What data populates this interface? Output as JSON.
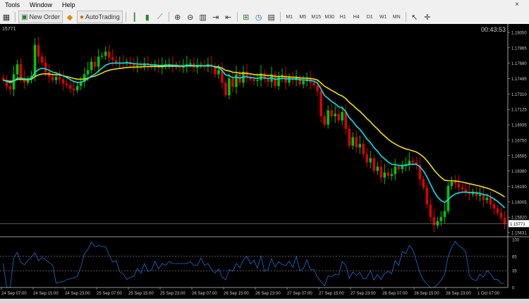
{
  "menu": {
    "items": [
      "Tools",
      "Window",
      "Help"
    ]
  },
  "toolbar": {
    "new_order_label": "New Order",
    "autotrading_label": "AutoTrading",
    "timeframes": [
      "M1",
      "M5",
      "M15",
      "M30",
      "H1",
      "H4",
      "D1",
      "W1",
      "MN"
    ],
    "icons": [
      "auto-scroll-icon",
      "chart-shift-icon",
      "bar-chart-icon",
      "zoom-in-icon",
      "zoom-out-icon",
      "tile-windows-icon",
      "indicators-icon",
      "periods-icon",
      "templates-icon",
      "cursor-icon",
      "crosshair-icon"
    ]
  },
  "chart": {
    "symbol_label": "15771",
    "countdown": "00:43:53",
    "current_price": "1.15771",
    "price_ticks": [
      "1.18050",
      "1.17865",
      "1.17680",
      "1.17495",
      "1.17310",
      "1.17125",
      "1.16935",
      "1.16750",
      "1.16565",
      "1.16380",
      "1.16190",
      "1.16005",
      "1.15820",
      "1.15631"
    ],
    "osc_ticks": [
      "100",
      "65",
      "35",
      "0"
    ],
    "time_ticks": [
      "24 Sep 07:00",
      "24 Sep 15:00",
      "24 Sep 23:00",
      "25 Sep 07:00",
      "25 Sep 15:00",
      "25 Sep 23:00",
      "26 Sep 07:00",
      "26 Sep 15:00",
      "26 Sep 23:00",
      "27 Sep 07:00",
      "27 Sep 15:00",
      "27 Sep 23:00",
      "28 Sep 07:00",
      "28 Sep 15:00",
      "28 Sep 23:00",
      "1 Oct 07:00"
    ],
    "colors": {
      "bull": "#00c800",
      "bear": "#e00000",
      "ma_fast": "#00e5ee",
      "ma_slow": "#f0e000",
      "osc": "#1e6ed8",
      "axis": "#c8c8c8"
    }
  },
  "chart_data": {
    "type": "candlestick",
    "ylim": [
      1.15631,
      1.1815
    ],
    "close": [
      1.1748,
      1.1741,
      1.1737,
      1.1755,
      1.1767,
      1.1751,
      1.1745,
      1.1749,
      1.1753,
      1.179,
      1.1776,
      1.1769,
      1.1758,
      1.1752,
      1.1748,
      1.1752,
      1.1749,
      1.1744,
      1.1742,
      1.1738,
      1.1736,
      1.1741,
      1.1746,
      1.1755,
      1.176,
      1.177,
      1.1764,
      1.1776,
      1.1777,
      1.1782,
      1.1775,
      1.1772,
      1.1768,
      1.1769,
      1.1768,
      1.177,
      1.1767,
      1.1765,
      1.1766,
      1.1765,
      1.1768,
      1.1766,
      1.1764,
      1.1766,
      1.1763,
      1.1765,
      1.1767,
      1.1767,
      1.1764,
      1.1766,
      1.1763,
      1.1765,
      1.1767,
      1.1768,
      1.1763,
      1.1765,
      1.1766,
      1.1764,
      1.1767,
      1.1764,
      1.1755,
      1.176,
      1.1745,
      1.173,
      1.175,
      1.174,
      1.1755,
      1.1745,
      1.1758,
      1.1752,
      1.1749,
      1.1747,
      1.1748,
      1.1756,
      1.1749,
      1.1746,
      1.1755,
      1.1741,
      1.1752,
      1.1754,
      1.1745,
      1.1751,
      1.1748,
      1.1751,
      1.1743,
      1.1747,
      1.1749,
      1.1745,
      1.1742,
      1.1735,
      1.1705,
      1.1695,
      1.1712,
      1.1705,
      1.1708,
      1.17,
      1.171,
      1.169,
      1.167,
      1.168,
      1.1668,
      1.1672,
      1.166,
      1.165,
      1.1655,
      1.164,
      1.1645,
      1.1632,
      1.1638,
      1.1634,
      1.1636,
      1.1645,
      1.1642,
      1.1646,
      1.1648,
      1.1652,
      1.165,
      1.1647,
      1.163,
      1.162,
      1.16,
      1.1585,
      1.1575,
      1.158,
      1.1585,
      1.1592,
      1.1622,
      1.1627,
      1.1625,
      1.162,
      1.1618,
      1.1615,
      1.1612,
      1.1615,
      1.161,
      1.1612,
      1.1605,
      1.1608,
      1.16,
      1.1595,
      1.159,
      1.1584,
      1.1577
    ]
  }
}
